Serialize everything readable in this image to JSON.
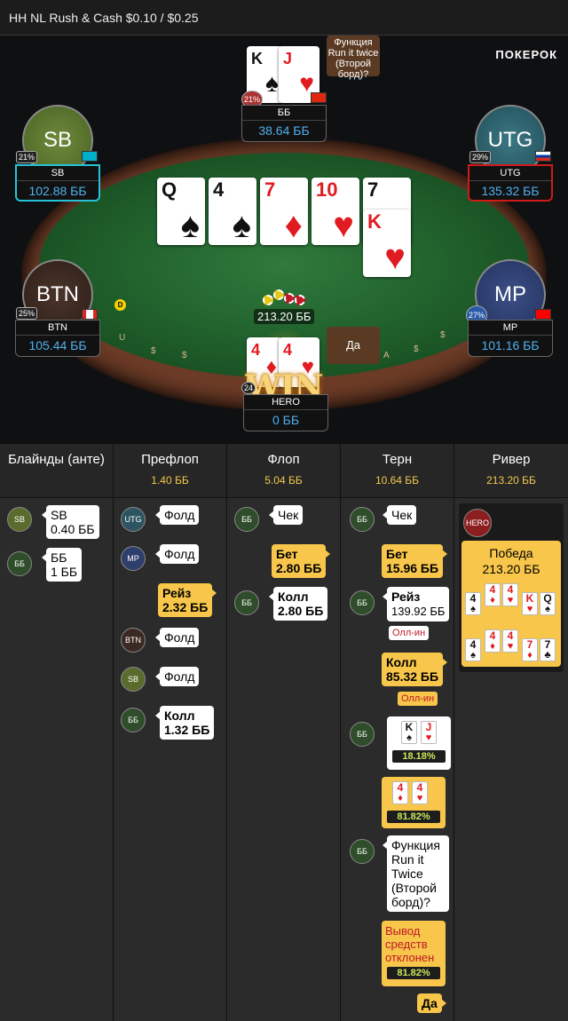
{
  "header": {
    "title": "HH NL Rush & Cash $0.10 / $0.25"
  },
  "brand": "ПОКЕРОК",
  "table": {
    "rail_text": [
      "U",
      "$",
      "$",
      "A",
      "$",
      "$"
    ],
    "pot": "213.20 ББ",
    "dealer": "D",
    "board": [
      {
        "rank": "Q",
        "suit": "♠",
        "color": "blk"
      },
      {
        "rank": "4",
        "suit": "♠",
        "color": "blk"
      },
      {
        "rank": "7",
        "suit": "♦",
        "color": "red"
      },
      {
        "rank": "10",
        "suit": "♥",
        "color": "red"
      },
      {
        "rank": "7",
        "suit": "♣",
        "color": "blk"
      },
      {
        "rank": "K",
        "suit": "♥",
        "color": "red"
      }
    ],
    "seats": {
      "bb": {
        "name": "ББ",
        "stack": "38.64 ББ",
        "pct": "21%",
        "cards": [
          {
            "rank": "K",
            "suit": "♠",
            "color": "blk"
          },
          {
            "rank": "J",
            "suit": "♥",
            "color": "red"
          }
        ]
      },
      "sb": {
        "label": "SB",
        "name": "SB",
        "stack": "102.88 ББ",
        "pct": "21%"
      },
      "utg": {
        "label": "UTG",
        "name": "UTG",
        "stack": "135.32 ББ",
        "pct": "29%"
      },
      "btn": {
        "label": "BTN",
        "name": "BTN",
        "stack": "105.44 ББ",
        "pct": "25%"
      },
      "mp": {
        "label": "MP",
        "name": "MP",
        "stack": "101.16 ББ",
        "pct": "27%"
      },
      "hero": {
        "name": "HERO",
        "stack": "0 ББ",
        "pct": "24",
        "cards": [
          {
            "rank": "4",
            "suit": "♦",
            "color": "red"
          },
          {
            "rank": "4",
            "suit": "♥",
            "color": "red"
          }
        ]
      }
    },
    "bubble_bb": "Функция Run it twice (Второй борд)?",
    "bubble_hero": "Да",
    "win": "WIN"
  },
  "history": {
    "columns": [
      {
        "title": "Блайнды (анте)",
        "value": ""
      },
      {
        "title": "Префлоп",
        "value": "1.40 ББ"
      },
      {
        "title": "Флоп",
        "value": "5.04 ББ"
      },
      {
        "title": "Терн",
        "value": "10.64 ББ"
      },
      {
        "title": "Ривер",
        "value": "213.20 ББ"
      }
    ],
    "blinds": [
      {
        "pos": "SB",
        "line1": "SB",
        "line2": "0.40 ББ"
      },
      {
        "pos": "ББ",
        "line1": "ББ",
        "line2": "1 ББ"
      }
    ],
    "preflop": [
      {
        "pos": "UTG",
        "text": "Фолд"
      },
      {
        "pos": "MP",
        "text": "Фолд"
      },
      {
        "line1": "Рейз",
        "line2": "2.32 ББ"
      },
      {
        "pos": "BTN",
        "text": "Фолд"
      },
      {
        "pos": "SB",
        "text": "Фолд"
      },
      {
        "pos": "ББ",
        "line1": "Колл",
        "line2": "1.32 ББ"
      }
    ],
    "flop": [
      {
        "pos": "ББ",
        "text": "Чек"
      },
      {
        "line1": "Бет",
        "line2": "2.80 ББ"
      },
      {
        "pos": "ББ",
        "line1": "Колл",
        "line2": "2.80 ББ"
      }
    ],
    "turn": [
      {
        "pos": "ББ",
        "text": "Чек"
      },
      {
        "line1": "Бет",
        "line2": "15.96 ББ"
      },
      {
        "pos": "ББ",
        "line1": "Рейз",
        "line2": "139.92 ББ",
        "tag": "Олл-ин"
      },
      {
        "line1": "Колл",
        "line2": "85.32 ББ",
        "tag": "Олл-ин"
      },
      {
        "pos": "ББ",
        "equity": "18.18%",
        "cards": [
          {
            "rank": "K",
            "suit": "♠",
            "color": "blk"
          },
          {
            "rank": "J",
            "suit": "♥",
            "color": "red"
          }
        ]
      },
      {
        "equity": "81.82%",
        "cards": [
          {
            "rank": "4",
            "suit": "♦",
            "color": "red"
          },
          {
            "rank": "4",
            "suit": "♥",
            "color": "red"
          }
        ]
      },
      {
        "pos": "ББ",
        "text": "Функция Run it Twice (Второй борд)?"
      },
      {
        "text": "Вывод средств отклонен",
        "equity": "81.82%"
      },
      {
        "text": "Да"
      }
    ],
    "river": {
      "pos": "HERO",
      "result": "Победа",
      "amount": "213.20 ББ",
      "hand1": [
        {
          "rank": "4",
          "suit": "♠",
          "color": "blk"
        },
        {
          "rank": "4",
          "suit": "♦",
          "color": "red"
        },
        {
          "rank": "4",
          "suit": "♥",
          "color": "red"
        },
        {
          "rank": "K",
          "suit": "♥",
          "color": "red"
        },
        {
          "rank": "Q",
          "suit": "♠",
          "color": "blk"
        }
      ],
      "hand2": [
        {
          "rank": "4",
          "suit": "♠",
          "color": "blk"
        },
        {
          "rank": "4",
          "suit": "♦",
          "color": "red"
        },
        {
          "rank": "4",
          "suit": "♥",
          "color": "red"
        },
        {
          "rank": "7",
          "suit": "♦",
          "color": "red"
        },
        {
          "rank": "7",
          "suit": "♣",
          "color": "blk"
        }
      ]
    }
  }
}
